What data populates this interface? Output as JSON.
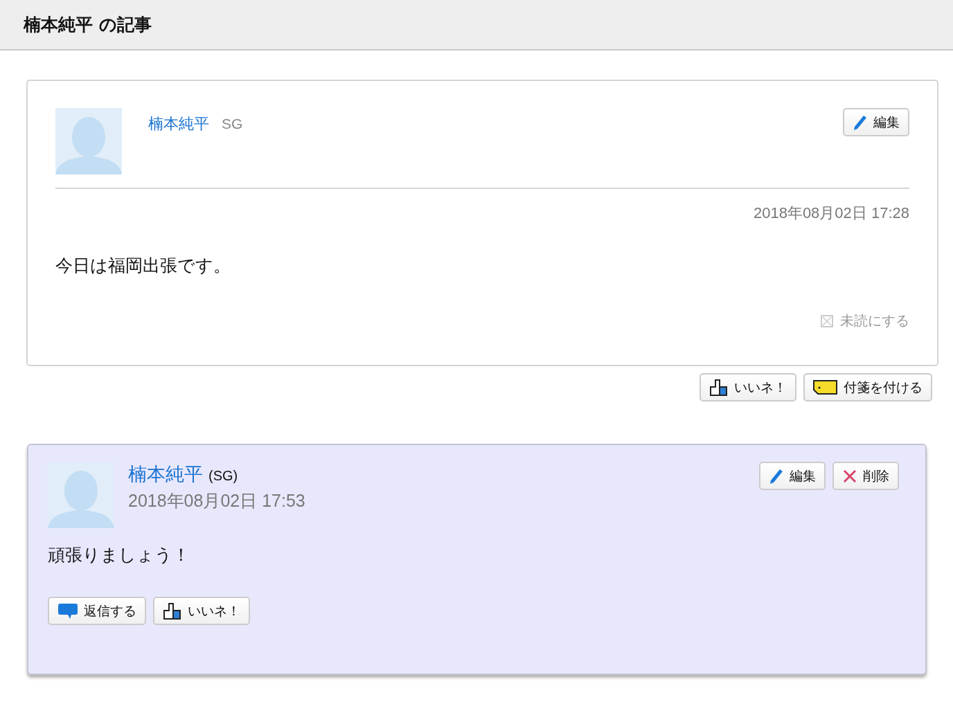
{
  "header": {
    "title": "楠本純平 の記事"
  },
  "article": {
    "author": "楠本純平",
    "group": "SG",
    "actions": [
      {
        "kind": "edit",
        "label": "編集"
      }
    ],
    "date": "2018年08月02日 17:28",
    "body": "今日は福岡出張です。",
    "mark_unread": {
      "label": "未読にする",
      "checked": false
    },
    "footer_actions": [
      {
        "kind": "like",
        "label": "いいネ！"
      },
      {
        "kind": "tag",
        "label": "付箋を付ける"
      }
    ]
  },
  "comments": [
    {
      "author": "楠本純平",
      "group": "(SG)",
      "date": "2018年08月02日 17:53",
      "actions": [
        {
          "kind": "edit",
          "label": "編集"
        },
        {
          "kind": "delete",
          "label": "削除"
        }
      ],
      "body": "頑張りましょう！",
      "footer_actions": [
        {
          "kind": "reply",
          "label": "返信する"
        },
        {
          "kind": "like",
          "label": "いいネ！"
        }
      ]
    }
  ]
}
